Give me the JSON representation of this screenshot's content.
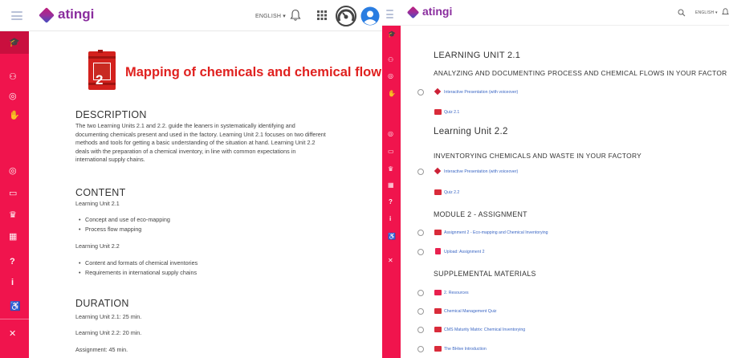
{
  "left": {
    "brand": "atingi",
    "language": "ENGLISH ▾",
    "module_number": "2",
    "module_title": "Mapping of chemicals and chemical flows",
    "description": {
      "heading": "DESCRIPTION",
      "lines": [
        "The two Learning Units 2.1 and 2.2. guide the leaners in systematically identifying and",
        "documenting chemicals present and used in the factory. Learning Unit 2.1 focuses on two different",
        "methods and tools for getting a basic understanding of the situation at hand. Learning Unit 2.2",
        "deals with the preparation of a chemical inventory, in line with common expectations in",
        "international supply chains."
      ]
    },
    "content": {
      "heading": "CONTENT",
      "unit1_label": "Learning Unit 2.1",
      "unit1_bullets": [
        "Concept and use of eco-mapping",
        "Process flow mapping"
      ],
      "unit2_label": "Learning Unit 2.2",
      "unit2_bullets": [
        "Content and formats of chemical inventories",
        "Requirements in international supply chains"
      ]
    },
    "duration": {
      "heading": "DURATION",
      "lines": [
        "Learning Unit 2.1: 25 min.",
        "Learning Unit 2.2: 20 min.",
        "Assignment: 45 min."
      ]
    }
  },
  "right": {
    "brand": "atingi",
    "language": "ENGLISH ▾",
    "unit1_title": "LEARNING UNIT 2.1",
    "unit1_subtitle": "ANALYZING AND DOCUMENTING PROCESS AND CHEMICAL FLOWS IN YOUR FACTOR",
    "unit1_items": [
      "Interactive Presentation (with voiceover)",
      "Quiz 2.1"
    ],
    "unit2_title": "Learning Unit 2.2",
    "unit2_subtitle": "INVENTORYING CHEMICALS AND WASTE IN YOUR FACTORY",
    "unit2_items": [
      "Interactive Presentation (with voiceover)",
      "Quiz 2.2"
    ],
    "assignment_title": "MODULE 2 - ASSIGNMENT",
    "assignment_items": [
      "Assignment 2 - Eco-mapping and Chemical Inventorying",
      "Upload: Assignment 2"
    ],
    "supplemental_title": "SUPPLEMENTAL MATERIALS",
    "supplemental_items": [
      "2. Resources",
      "Chemical Management Quiz",
      "CMS Maturity Matrix: Chemical Inventorying",
      "The BHive Introduction"
    ]
  },
  "colors": {
    "accent": "#f0144d",
    "brand": "#8a2d9e",
    "link": "#3a66c4",
    "module_red": "#e0211f"
  }
}
